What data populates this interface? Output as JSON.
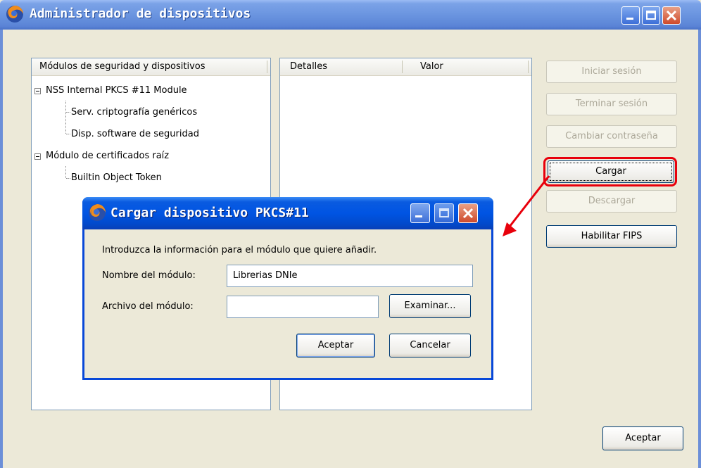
{
  "window": {
    "title": "Administrador de dispositivos",
    "icon": "firefox-icon",
    "controls": [
      "minimize-icon",
      "maximize-icon",
      "close-icon"
    ]
  },
  "modules_panel": {
    "header": "Módulos de seguridad y dispositivos",
    "tree": [
      {
        "label": "NSS Internal PKCS #11 Module",
        "expanded": true,
        "children": [
          "Serv. criptografía genéricos",
          "Disp. software de seguridad"
        ]
      },
      {
        "label": "Módulo de certificados raíz",
        "expanded": true,
        "children": [
          "Builtin Object Token"
        ]
      }
    ]
  },
  "details_panel": {
    "columns": [
      "Detalles",
      "Valor"
    ]
  },
  "side_buttons": {
    "login": {
      "label": "Iniciar sesión",
      "enabled": false
    },
    "logout": {
      "label": "Terminar sesión",
      "enabled": false
    },
    "change_password": {
      "label": "Cambiar contraseña",
      "enabled": false
    },
    "load": {
      "label": "Cargar",
      "enabled": true,
      "highlighted": true
    },
    "unload": {
      "label": "Descargar",
      "enabled": false
    },
    "enable_fips": {
      "label": "Habilitar FIPS",
      "enabled": true
    }
  },
  "ok_button": {
    "label": "Aceptar"
  },
  "dialog": {
    "title": "Cargar dispositivo PKCS#11",
    "icon": "firefox-icon",
    "controls": [
      "minimize-icon",
      "maximize-icon",
      "close-icon"
    ],
    "instruction": "Introduzca la información para el módulo que quiere añadir.",
    "module_name": {
      "label": "Nombre del módulo:",
      "value": "Librerias DNIe"
    },
    "module_file": {
      "label": "Archivo del módulo:",
      "value": ""
    },
    "browse": {
      "label": "Examinar..."
    },
    "accept": {
      "label": "Aceptar"
    },
    "cancel": {
      "label": "Cancelar"
    }
  },
  "annotation": {
    "color": "#e8000b"
  }
}
